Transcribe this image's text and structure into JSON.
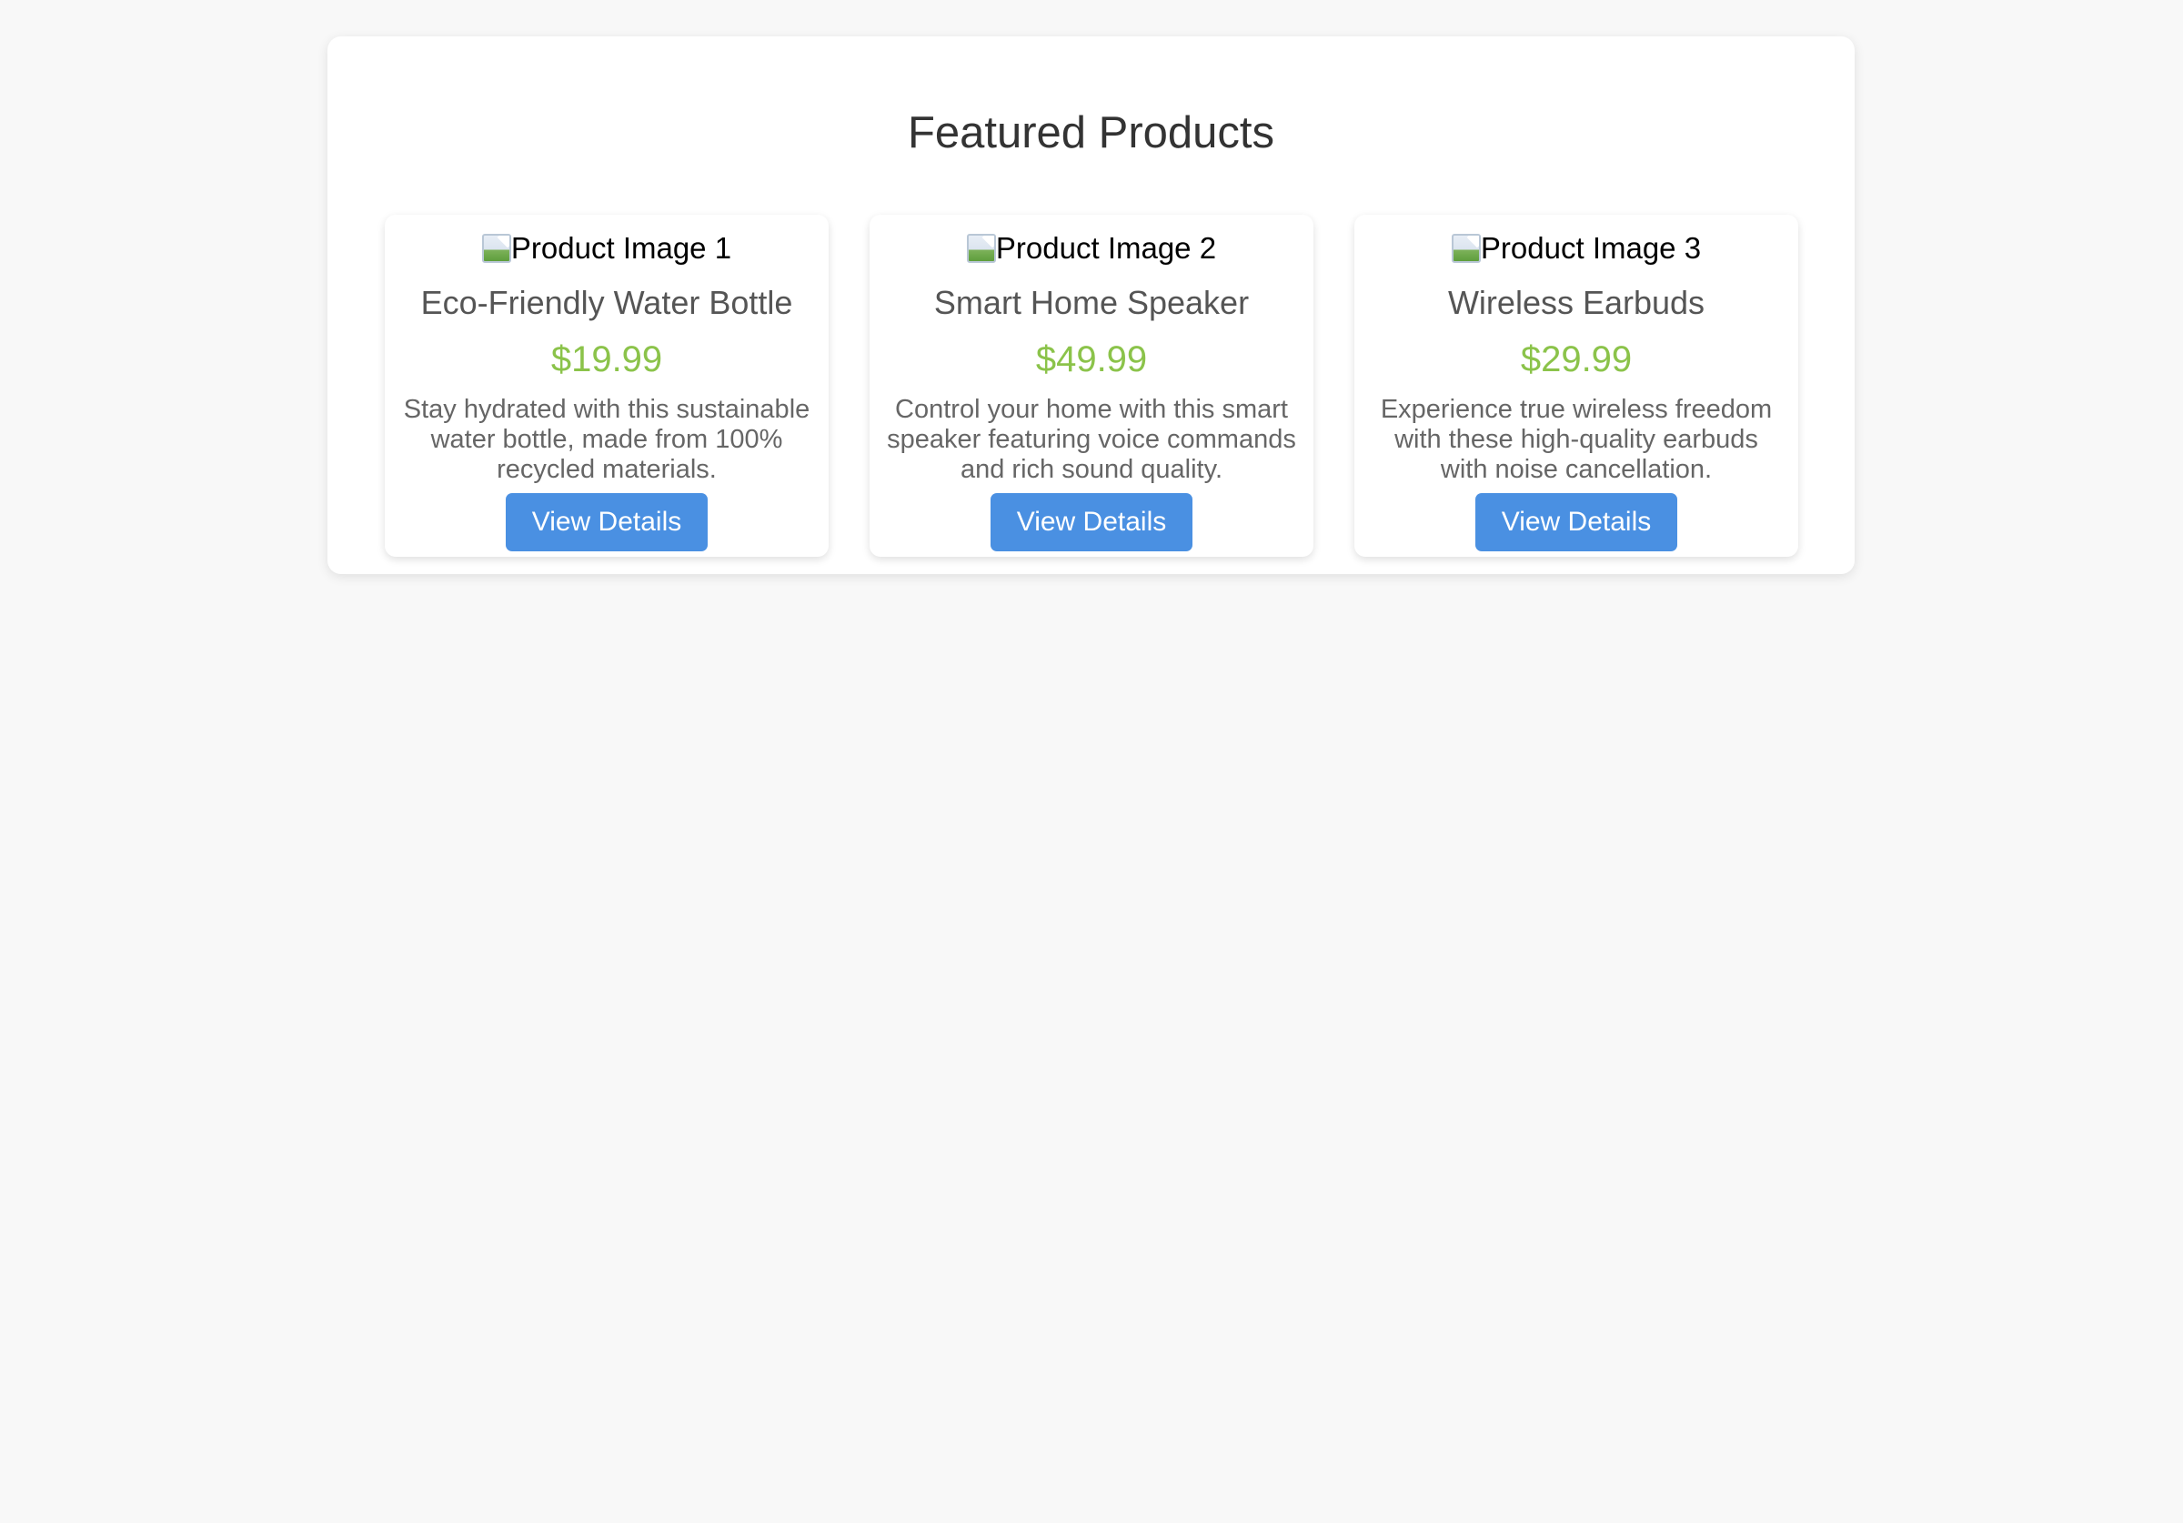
{
  "page": {
    "title": "Featured Products"
  },
  "colors": {
    "background": "#f8f8f8",
    "panel": "#ffffff",
    "price": "#8bc34a",
    "button": "#4a90e2",
    "title_text": "#333333"
  },
  "products": [
    {
      "image_alt": "Product Image 1",
      "name": "Eco-Friendly Water Bottle",
      "price": "$19.99",
      "description": "Stay hydrated with this sustainable water bottle, made from 100% recycled materials.",
      "button_label": "View Details",
      "image_icon": "broken-image-icon"
    },
    {
      "image_alt": "Product Image 2",
      "name": "Smart Home Speaker",
      "price": "$49.99",
      "description": "Control your home with this smart speaker featuring voice commands and rich sound quality.",
      "button_label": "View Details",
      "image_icon": "broken-image-icon"
    },
    {
      "image_alt": "Product Image 3",
      "name": "Wireless Earbuds",
      "price": "$29.99",
      "description": "Experience true wireless freedom with these high-quality earbuds with noise cancellation.",
      "button_label": "View Details",
      "image_icon": "broken-image-icon"
    }
  ]
}
